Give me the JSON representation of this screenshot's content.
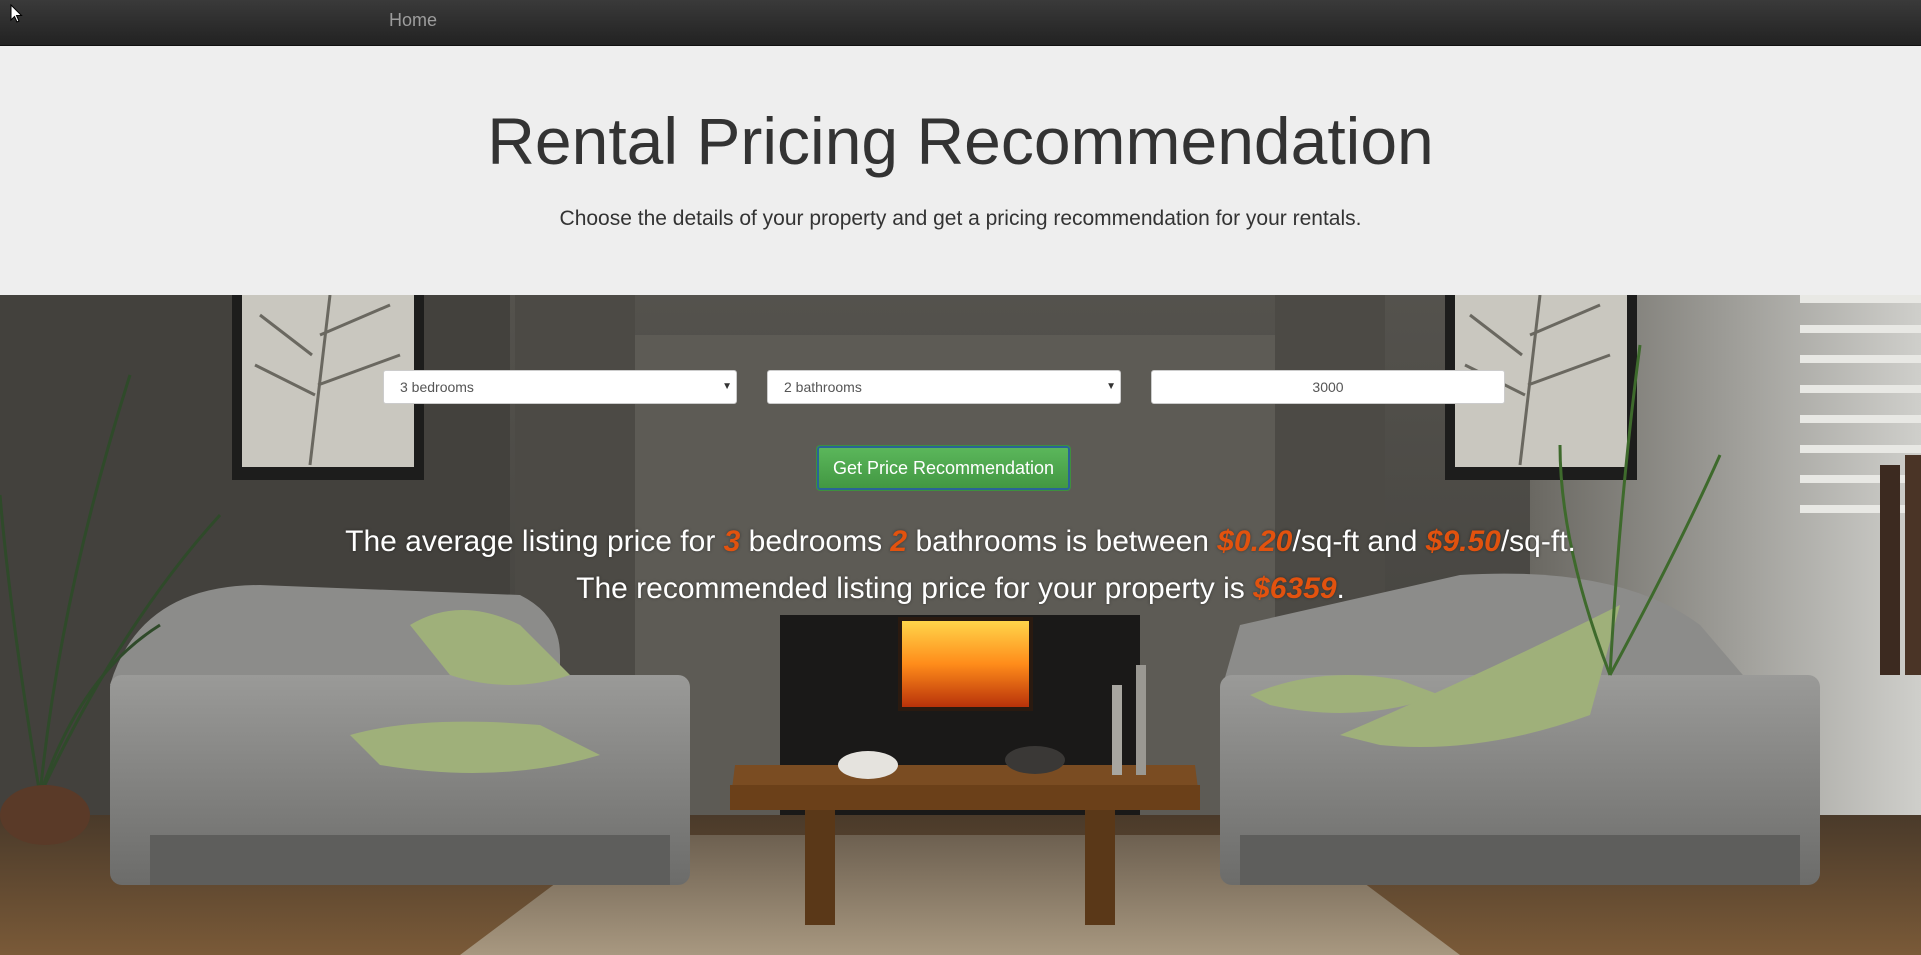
{
  "nav": {
    "home_label": "Home"
  },
  "header": {
    "title": "Rental Pricing Recommendation",
    "subtitle": "Choose the details of your property and get a pricing recommendation for your rentals."
  },
  "form": {
    "bedrooms_selected": "3 bedrooms",
    "bathrooms_selected": "2 bathrooms",
    "sqft_value": "3000",
    "submit_label": "Get Price Recommendation"
  },
  "result": {
    "line1_a": "The average listing price for ",
    "bedrooms": "3",
    "line1_b": " bedrooms ",
    "bathrooms": "2",
    "line1_c": " bathrooms is between ",
    "low_price": "$0.20",
    "line1_d": "/sq-ft and ",
    "high_price": "$9.50",
    "line1_e": "/sq-ft.",
    "line2_a": "The recommended listing price for your property is ",
    "recommended_price": "$6359",
    "line2_b": "."
  },
  "colors": {
    "highlight": "#e2520e",
    "button": "#449d44",
    "navbar": "#222222",
    "jumbotron": "#eeeeee"
  }
}
